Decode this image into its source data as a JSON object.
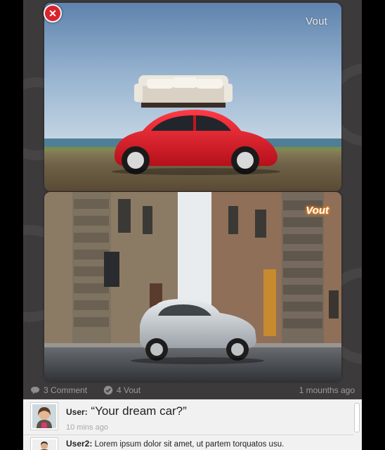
{
  "close": {
    "icon": "close-icon",
    "color": "#d8242e"
  },
  "photos": [
    {
      "vote_label": "Vout",
      "state": "default"
    },
    {
      "vote_label": "Vout",
      "state": "highlighted",
      "highlight_color": "#ff8a1c"
    }
  ],
  "stats": {
    "comments": "3 Comment",
    "votes": "4 Vout",
    "posted": "1 mounths ago"
  },
  "comments": [
    {
      "user": "User:",
      "text": "“Your dream car?”",
      "time": "10 mins ago"
    },
    {
      "user": "User2:",
      "text": "Lorem ipsum dolor sit amet, ut partem torquatos usu."
    }
  ]
}
